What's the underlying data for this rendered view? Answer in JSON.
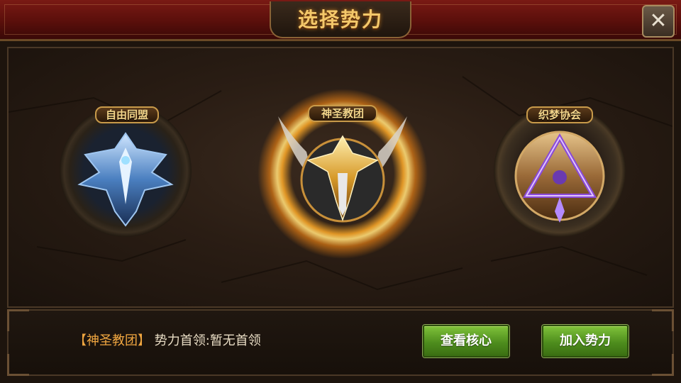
{
  "title": "选择势力",
  "close_icon": "close-x-icon",
  "factions": [
    {
      "name": "自由同盟",
      "theme": "blue",
      "selected": false
    },
    {
      "name": "神圣教团",
      "theme": "gold",
      "selected": true
    },
    {
      "name": "织梦协会",
      "theme": "purple",
      "selected": false
    }
  ],
  "info": {
    "selected_faction": "神圣教团",
    "leader_label": "势力首领:",
    "leader_value": "暂无首领"
  },
  "buttons": {
    "view_core": "查看核心",
    "join": "加入势力"
  },
  "colors": {
    "title_text": "#f4c86a",
    "titlebar_red": "#6a130e",
    "button_green": "#5a9e22",
    "bracket_orange": "#f0a640"
  }
}
